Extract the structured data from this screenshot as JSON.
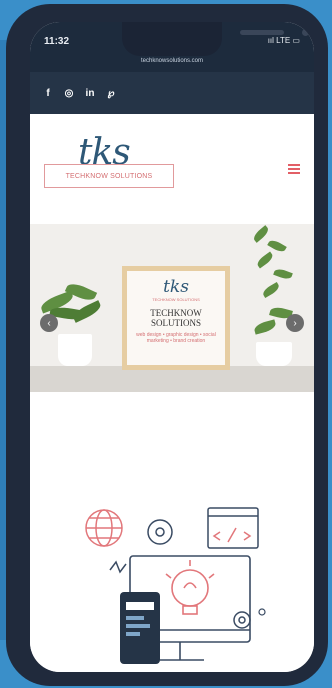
{
  "status_bar": {
    "time": "11:32",
    "icons": "ııl LTE ▭",
    "url": "techknowsolutions.com"
  },
  "social": [
    {
      "name": "facebook-icon",
      "glyph": "f"
    },
    {
      "name": "instagram-icon",
      "glyph": "◎"
    },
    {
      "name": "linkedin-icon",
      "glyph": "in"
    },
    {
      "name": "pinterest-icon",
      "glyph": "℘"
    }
  ],
  "header": {
    "logo_mark": "tks",
    "logo_text": "TECHKNOW SOLUTIONS",
    "menu_icon": "hamburger-icon"
  },
  "hero": {
    "frame_mark": "tks",
    "frame_small": "TECHKNOW SOLUTIONS",
    "frame_title_1": "TECHKNOW",
    "frame_title_2": "SOLUTIONS",
    "frame_script": "web design • graphic design • social marketing • brand creation",
    "prev_icon": "‹",
    "next_icon": "›"
  },
  "colors": {
    "accent": "#e25f66",
    "navy": "#253447",
    "brand_blue": "#2e5877"
  }
}
